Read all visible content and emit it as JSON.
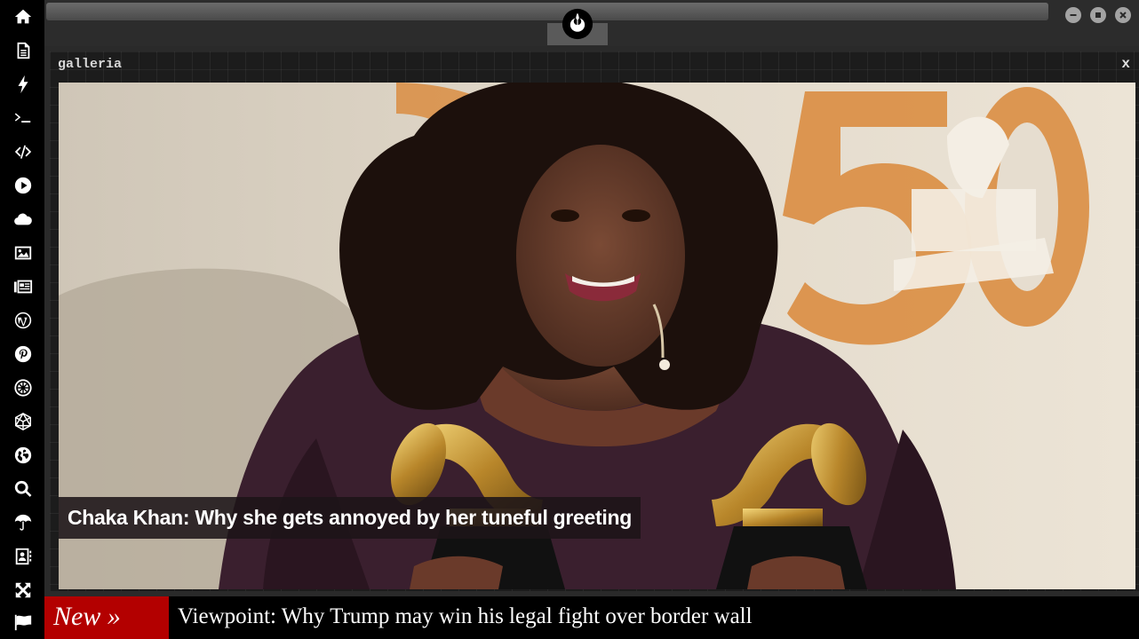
{
  "sidebar": {
    "items": [
      {
        "icon": "home-icon"
      },
      {
        "icon": "document-icon"
      },
      {
        "icon": "bolt-icon"
      },
      {
        "icon": "terminal-icon"
      },
      {
        "icon": "code-icon"
      },
      {
        "icon": "play-icon"
      },
      {
        "icon": "cloud-icon"
      },
      {
        "icon": "image-icon"
      },
      {
        "icon": "newspaper-icon"
      },
      {
        "icon": "wordpress-icon"
      },
      {
        "icon": "pinterest-icon"
      },
      {
        "icon": "galactic-empire-icon"
      },
      {
        "icon": "network-icon"
      },
      {
        "icon": "globe-icon"
      },
      {
        "icon": "search-icon"
      },
      {
        "icon": "umbrella-icon"
      },
      {
        "icon": "contact-card-icon"
      },
      {
        "icon": "expand-icon"
      },
      {
        "icon": "flag-icon"
      }
    ]
  },
  "window": {
    "logo": "rebel-alliance-icon",
    "controls": [
      "minimize-icon",
      "maximize-icon",
      "close-icon"
    ]
  },
  "panel": {
    "title": "galleria",
    "close_label": "x",
    "caption": "Chaka Khan: Why she gets annoyed by her tuneful greeting"
  },
  "ticker": {
    "label": "New »",
    "headline": "Viewpoint: Why Trump may win his legal fight over border wall"
  },
  "colors": {
    "sidebar_bg": "#000000",
    "ticker_label_bg": "#b30000",
    "panel_bg": "#1c1c1c"
  }
}
